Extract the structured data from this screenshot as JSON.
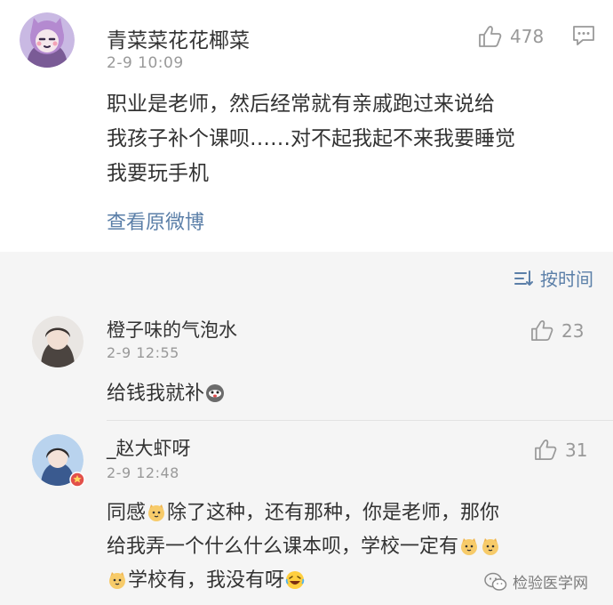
{
  "main_post": {
    "username": "青菜菜花花椰菜",
    "timestamp": "2-9 10:09",
    "like_count": "478",
    "body_lines": [
      "职业是老师，然后经常就有亲戚跑过来说给",
      "我孩子补个课呗……对不起我起不来我要睡觉",
      "我要玩手机"
    ],
    "view_original_label": "查看原微博"
  },
  "sort": {
    "label": "按时间",
    "icon": "sort-lines-icon"
  },
  "replies": [
    {
      "username": "橙子味的气泡水",
      "timestamp": "2-9 12:55",
      "like_count": "23",
      "text_a": "给钱我就补"
    },
    {
      "username": "_赵大虾呀",
      "timestamp": "2-9 12:48",
      "like_count": "31",
      "line1_a": "同感",
      "line1_b": "除了这种，还有那种，你是老师，那你",
      "line2_a": "给我弄一个什么什么课本呗，学校一定有",
      "line3_a": "学校有，我没有呀"
    }
  ],
  "watermark": {
    "text": "检验医学网",
    "icon": "wechat-icon"
  },
  "colors": {
    "link": "#5b7fa8",
    "meta": "#999999",
    "text": "#333333",
    "gray_background": "#f5f5f5"
  }
}
